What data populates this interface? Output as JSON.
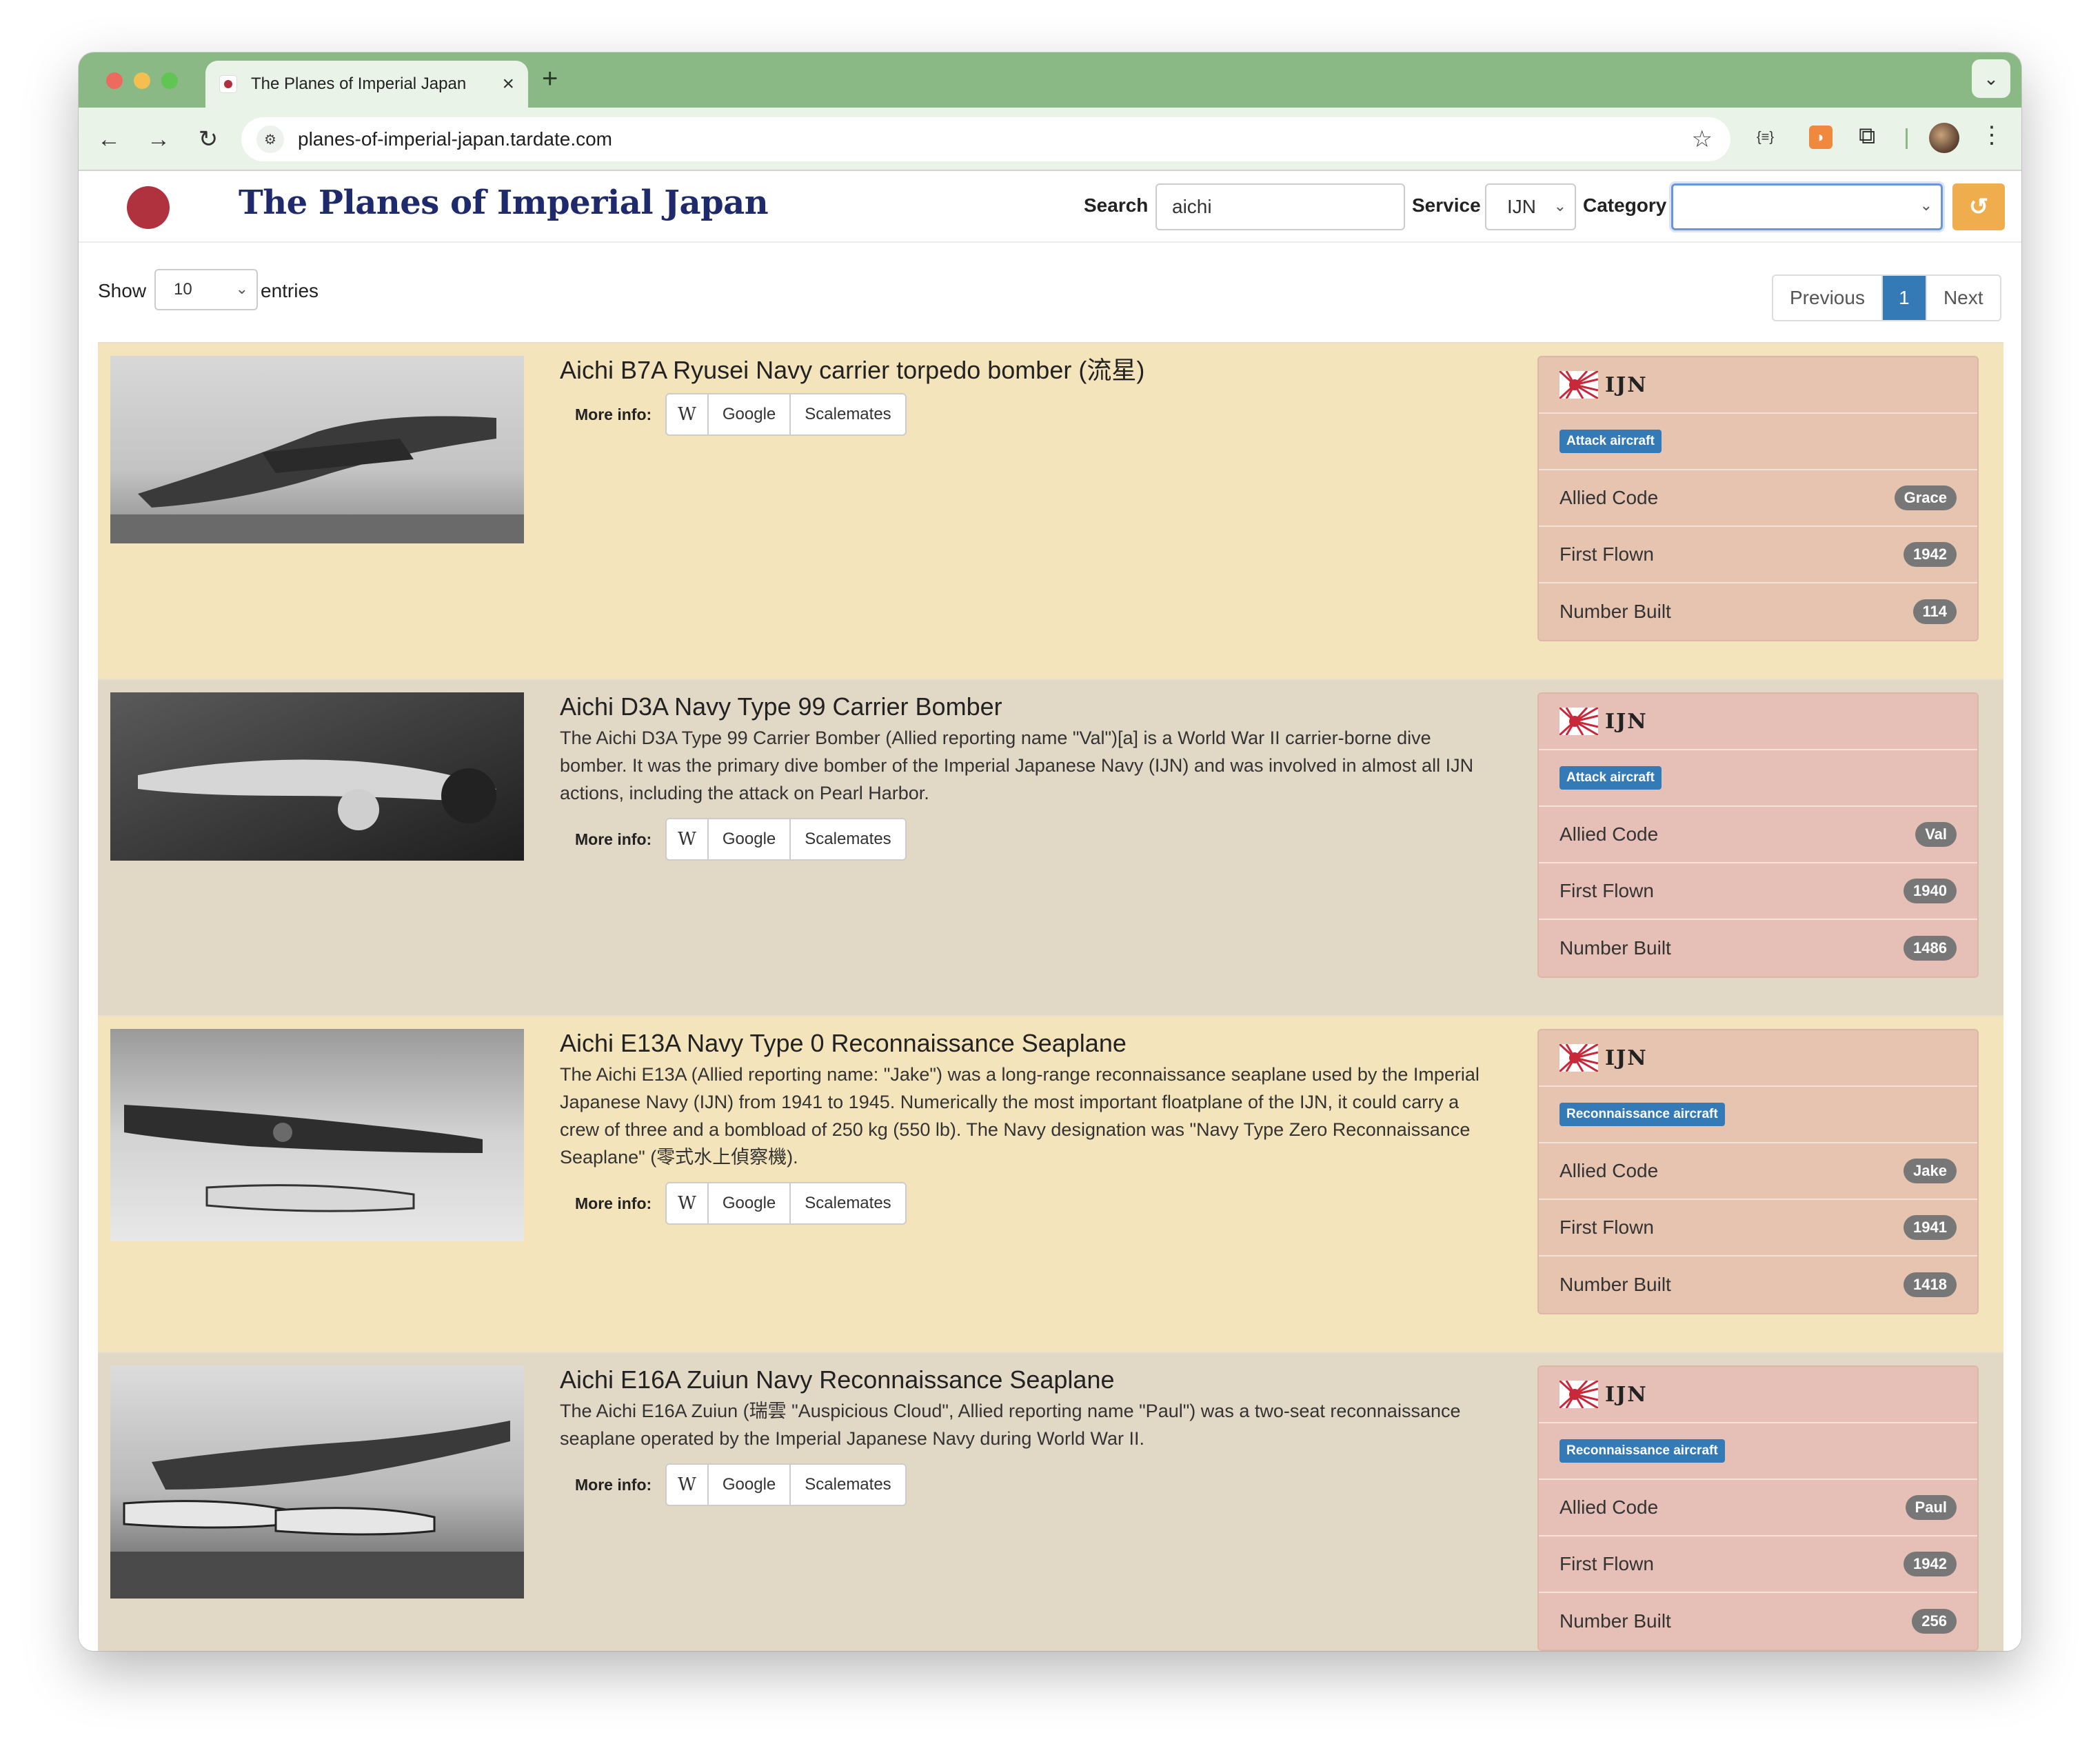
{
  "browser": {
    "tab_title": "The Planes of Imperial Japan",
    "url": "planes-of-imperial-japan.tardate.com"
  },
  "header": {
    "site_title": "The Planes of Imperial Japan",
    "search_label": "Search",
    "search_value": "aichi",
    "service_label": "Service",
    "service_value": "IJN",
    "category_label": "Category",
    "category_value": ""
  },
  "table_controls": {
    "show_label": "Show",
    "length_value": "10",
    "entries_label": "entries",
    "pager": {
      "previous": "Previous",
      "current": "1",
      "next": "Next"
    }
  },
  "more_info": {
    "label": "More info:",
    "wiki": "W",
    "google": "Google",
    "scalemates": "Scalemates"
  },
  "card_labels": {
    "allied_code": "Allied Code",
    "first_flown": "First Flown",
    "number_built": "Number Built",
    "service_mark": "IJN"
  },
  "planes": [
    {
      "title": "Aichi B7A Ryusei Navy carrier torpedo bomber (流星)",
      "description": "",
      "category": "Attack aircraft",
      "allied_code": "Grace",
      "first_flown": "1942",
      "number_built": "114"
    },
    {
      "title": "Aichi D3A Navy Type 99 Carrier Bomber",
      "description": "The Aichi D3A Type 99 Carrier Bomber (Allied reporting name \"Val\")[a] is a World War II carrier-borne dive bomber. It was the primary dive bomber of the Imperial Japanese Navy (IJN) and was involved in almost all IJN actions, including the attack on Pearl Harbor.",
      "category": "Attack aircraft",
      "allied_code": "Val",
      "first_flown": "1940",
      "number_built": "1486"
    },
    {
      "title": "Aichi E13A Navy Type 0 Reconnaissance Seaplane",
      "description": "The Aichi E13A (Allied reporting name: \"Jake\") was a long-range reconnaissance seaplane used by the Imperial Japanese Navy (IJN) from 1941 to 1945. Numerically the most important floatplane of the IJN, it could carry a crew of three and a bombload of 250 kg (550 lb). The Navy designation was \"Navy Type Zero Reconnaissance Seaplane\" (零式水上偵察機).",
      "category": "Reconnaissance aircraft",
      "allied_code": "Jake",
      "first_flown": "1941",
      "number_built": "1418"
    },
    {
      "title": "Aichi E16A Zuiun Navy Reconnaissance Seaplane",
      "description": "The Aichi E16A Zuiun (瑞雲 \"Auspicious Cloud\", Allied reporting name \"Paul\") was a two-seat reconnaissance seaplane operated by the Imperial Japanese Navy during World War II.",
      "category": "Reconnaissance aircraft",
      "allied_code": "Paul",
      "first_flown": "1942",
      "number_built": "256"
    }
  ]
}
